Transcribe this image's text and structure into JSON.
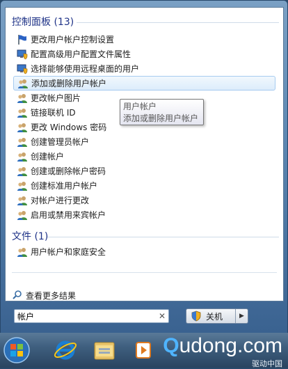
{
  "groups": [
    {
      "title": "控制面板 (13)",
      "items": [
        {
          "label": "更改用户帐户控制设置",
          "icon": "flag-icon"
        },
        {
          "label": "配置高级用户配置文件属性",
          "icon": "monitor-shield-icon"
        },
        {
          "label": "选择能够使用远程桌面的用户",
          "icon": "monitor-shield-icon"
        },
        {
          "label": "添加或删除用户帐户",
          "icon": "users-icon",
          "selected": true
        },
        {
          "label": "更改帐户图片",
          "icon": "users-icon"
        },
        {
          "label": "链接联机 ID",
          "icon": "users-icon"
        },
        {
          "label": "更改 Windows 密码",
          "icon": "users-icon"
        },
        {
          "label": "创建管理员帐户",
          "icon": "users-icon"
        },
        {
          "label": "创建帐户",
          "icon": "users-icon"
        },
        {
          "label": "创建或删除帐户密码",
          "icon": "users-icon"
        },
        {
          "label": "创建标准用户帐户",
          "icon": "users-icon"
        },
        {
          "label": "对帐户进行更改",
          "icon": "users-icon"
        },
        {
          "label": "启用或禁用来宾帐户",
          "icon": "users-icon"
        }
      ]
    },
    {
      "title": "文件 (1)",
      "items": [
        {
          "label": "用户帐户和家庭安全",
          "icon": "users-icon"
        }
      ]
    }
  ],
  "tooltip": {
    "line1": "用户帐户",
    "line2": "添加或删除用户帐户"
  },
  "see_more": "查看更多结果",
  "search": {
    "value": "帐户",
    "clear_glyph": "✕"
  },
  "shutdown": {
    "label": "关机"
  },
  "brand": {
    "name_q": "Q",
    "name_rest": "udong.com",
    "sub": "驱动中国"
  },
  "colors": {
    "header": "#1e3287",
    "selection_border": "#a6cbf0"
  }
}
